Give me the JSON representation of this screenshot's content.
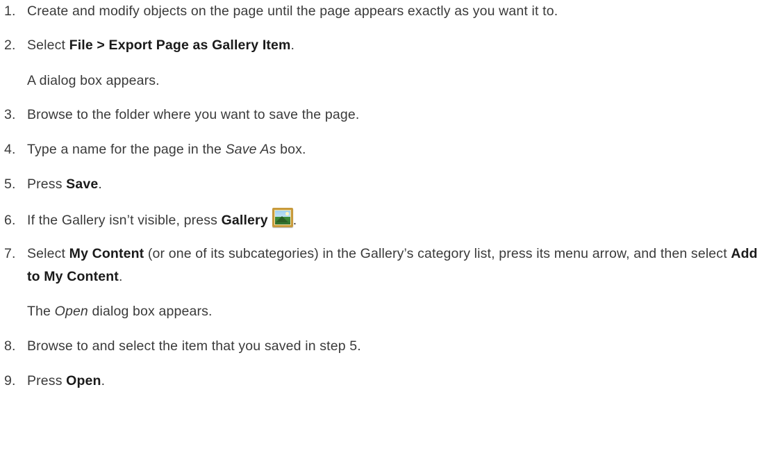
{
  "steps": [
    {
      "num": "1.",
      "text": "Create and modify objects on the page until the page appears exactly as you want it to."
    },
    {
      "num": "2.",
      "pre": "Select ",
      "strong": "File > Export Page as Gallery Item",
      "post": ".",
      "note": "A dialog box appears."
    },
    {
      "num": "3.",
      "text": "Browse to the folder where you want to save the page."
    },
    {
      "num": "4.",
      "pre": "Type a name for the page in the ",
      "em": "Save As",
      "post": " box."
    },
    {
      "num": "5.",
      "pre": "Press ",
      "strong": "Save",
      "post": "."
    },
    {
      "num": "6.",
      "pre": "If the Gallery isn’t visible, press ",
      "strong": "Gallery",
      "post": ".",
      "icon": "gallery-icon"
    },
    {
      "num": "7.",
      "pre": "Select ",
      "strong": "My Content",
      "mid": " (or one of its subcategories) in the Gallery’s category list, press its menu arrow, and then select ",
      "strong2": "Add to My Content",
      "post": ".",
      "note_pre": "The ",
      "note_em": "Open",
      "note_post": " dialog box appears."
    },
    {
      "num": "8.",
      "text": "Browse to and select the item that you saved in step 5."
    },
    {
      "num": "9.",
      "pre": "Press ",
      "strong": "Open",
      "post": "."
    }
  ]
}
